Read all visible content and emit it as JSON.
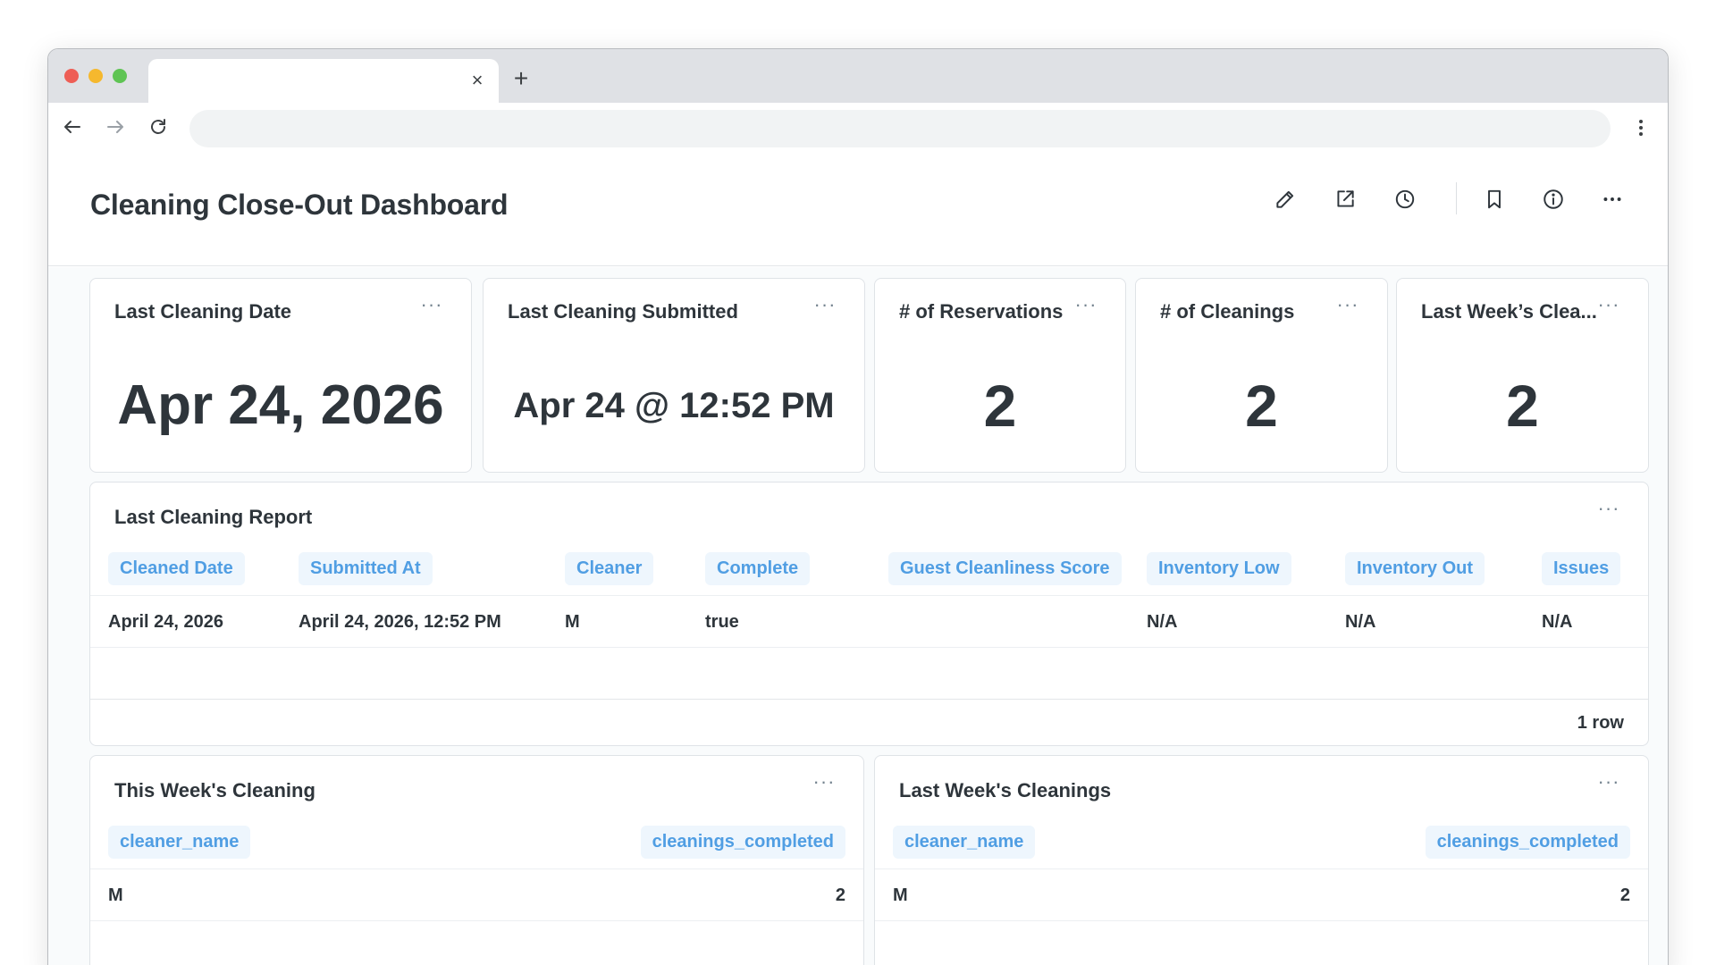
{
  "browser": {
    "tab_title": "",
    "tab_close": "×",
    "new_tab": "+",
    "address": ""
  },
  "header": {
    "title": "Cleaning Close-Out Dashboard",
    "icons": [
      "pencil-icon",
      "share-icon",
      "history-icon",
      "bookmark-icon",
      "info-icon",
      "more-icon"
    ]
  },
  "scalars": [
    {
      "title": "Last Cleaning Date",
      "value": "Apr 24, 2026"
    },
    {
      "title": "Last Cleaning Submitted",
      "value": "Apr 24 @ 12:52 PM"
    },
    {
      "title": "# of Reservations",
      "value": "2"
    },
    {
      "title": "# of Cleanings",
      "value": "2"
    },
    {
      "title": "Last Week’s Clea...",
      "value": "2"
    }
  ],
  "report": {
    "title": "Last Cleaning Report",
    "columns": [
      "Cleaned Date",
      "Submitted At",
      "Cleaner",
      "Complete",
      "Guest Cleanliness Score",
      "Inventory Low",
      "Inventory Out",
      "Issues"
    ],
    "rows": [
      [
        "April 24, 2026",
        "April 24, 2026, 12:52 PM",
        "M",
        "true",
        "",
        "N/A",
        "N/A",
        "N/A"
      ]
    ],
    "row_count": "1 row"
  },
  "this_week": {
    "title": "This Week's Cleaning",
    "columns": [
      "cleaner_name",
      "cleanings_completed"
    ],
    "rows": [
      [
        "M",
        "2"
      ]
    ]
  },
  "last_week": {
    "title": "Last Week's Cleanings",
    "columns": [
      "cleaner_name",
      "cleanings_completed"
    ],
    "rows": [
      [
        "M",
        "2"
      ]
    ]
  },
  "menu_glyph": "···",
  "colors": {
    "accent": "#509ee3",
    "header_chip_bg": "#eef6fd",
    "text": "#2e353b",
    "chrome": "#dfe1e5"
  }
}
